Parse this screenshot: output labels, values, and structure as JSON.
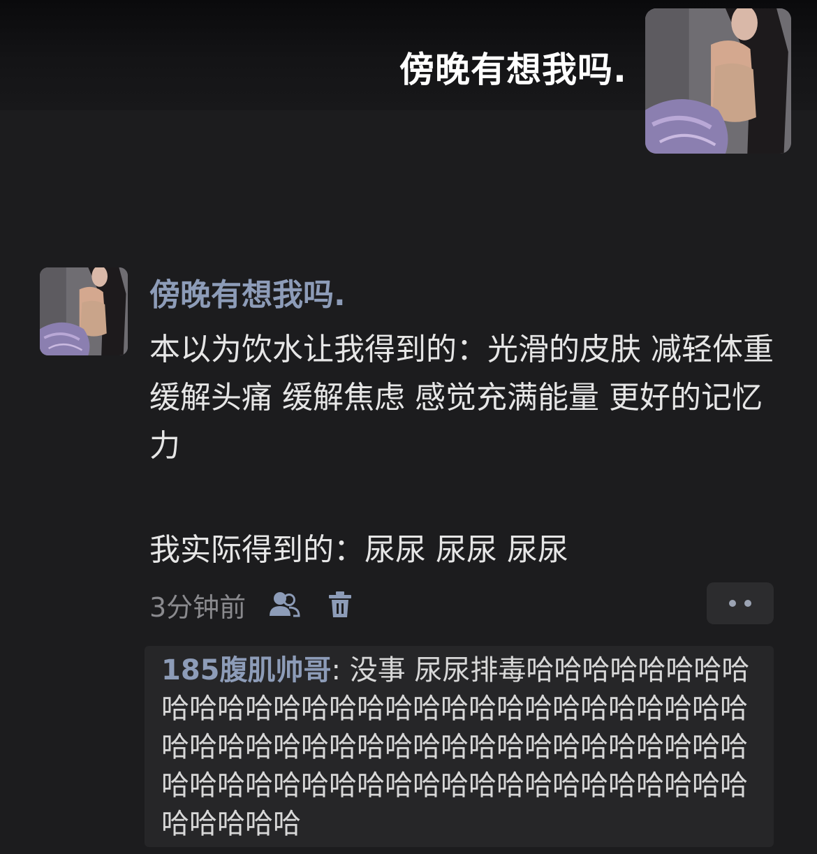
{
  "header": {
    "display_name": "傍晚有想我吗.",
    "avatar_icon": "user-avatar-photo"
  },
  "post": {
    "author": "傍晚有想我吗.",
    "avatar_icon": "user-avatar-photo",
    "body_paragraph_1": "本以为饮水让我得到的：光滑的皮肤 减轻体重 缓解头痛 缓解焦虑 感觉充满能量 更好的记忆力",
    "body_paragraph_2": "我实际得到的：尿尿 尿尿 尿尿",
    "time": "3分钟前",
    "icons": {
      "visibility": "friends-visibility-icon",
      "delete": "trash-icon",
      "more": "more-dots-icon"
    }
  },
  "comments": [
    {
      "author": "185腹肌帅哥",
      "separator": ": ",
      "text": "没事 尿尿排毒哈哈哈哈哈哈哈哈哈哈哈哈哈哈哈哈哈哈哈哈哈哈哈哈哈哈哈哈哈哈哈哈哈哈哈哈哈哈哈哈哈哈哈哈哈哈哈哈哈哈哈哈哈哈哈哈哈哈哈哈哈哈哈哈哈哈哈哈哈哈哈哈哈哈哈哈"
    }
  ],
  "colors": {
    "background": "#1c1c1e",
    "accent_name": "#8d9cb8",
    "body_text": "#e6e6e6",
    "muted_text": "#8a8a8e",
    "comment_bg": "#262628"
  }
}
